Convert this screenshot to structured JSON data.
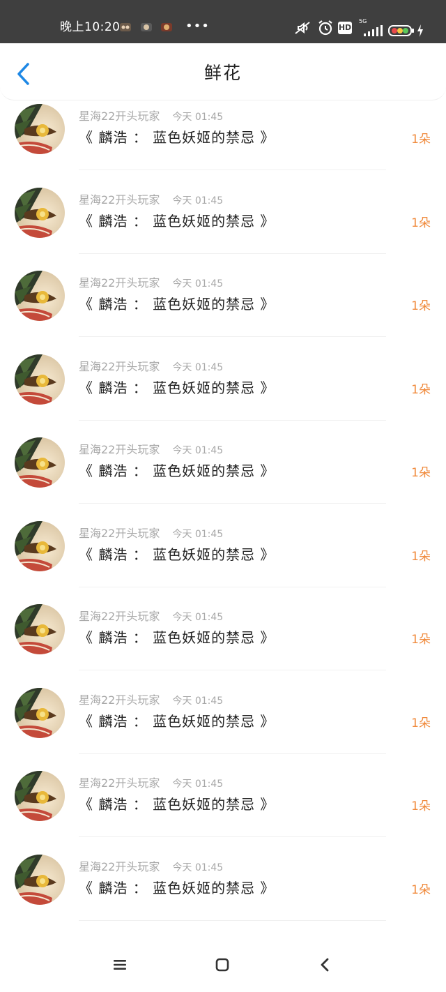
{
  "status_bar": {
    "time": "晚上10:20",
    "more": "•••",
    "hd_label": "HD",
    "network_label": "5G",
    "notification_icons": [
      "app-icon-a",
      "app-icon-b",
      "app-icon-c"
    ],
    "right_icons": [
      "mute-icon",
      "alarm-icon",
      "hd-icon",
      "signal-icon",
      "battery-icon",
      "charging-icon"
    ]
  },
  "header": {
    "title": "鲜花",
    "back_icon": "chevron-left-icon"
  },
  "records": [
    {
      "user": "星海22开头玩家",
      "time": "今天 01:45",
      "title": "《 麟浩 ： 蓝色妖姬的禁忌 》",
      "count": "1朵"
    },
    {
      "user": "星海22开头玩家",
      "time": "今天 01:45",
      "title": "《 麟浩 ： 蓝色妖姬的禁忌 》",
      "count": "1朵"
    },
    {
      "user": "星海22开头玩家",
      "time": "今天 01:45",
      "title": "《 麟浩 ： 蓝色妖姬的禁忌 》",
      "count": "1朵"
    },
    {
      "user": "星海22开头玩家",
      "time": "今天 01:45",
      "title": "《 麟浩 ： 蓝色妖姬的禁忌 》",
      "count": "1朵"
    },
    {
      "user": "星海22开头玩家",
      "time": "今天 01:45",
      "title": "《 麟浩 ： 蓝色妖姬的禁忌 》",
      "count": "1朵"
    },
    {
      "user": "星海22开头玩家",
      "time": "今天 01:45",
      "title": "《 麟浩 ： 蓝色妖姬的禁忌 》",
      "count": "1朵"
    },
    {
      "user": "星海22开头玩家",
      "time": "今天 01:45",
      "title": "《 麟浩 ： 蓝色妖姬的禁忌 》",
      "count": "1朵"
    },
    {
      "user": "星海22开头玩家",
      "time": "今天 01:45",
      "title": "《 麟浩 ： 蓝色妖姬的禁忌 》",
      "count": "1朵"
    },
    {
      "user": "星海22开头玩家",
      "time": "今天 01:45",
      "title": "《 麟浩 ： 蓝色妖姬的禁忌 》",
      "count": "1朵"
    },
    {
      "user": "星海22开头玩家",
      "time": "今天 01:45",
      "title": "《 麟浩 ： 蓝色妖姬的禁忌 》",
      "count": "1朵"
    }
  ],
  "nav_bar": {
    "menu_icon": "menu-icon",
    "home_icon": "home-square-icon",
    "back_icon": "back-chevron-icon"
  },
  "colors": {
    "status_bar_bg": "#3f3f3f",
    "accent_blue": "#1e88e5",
    "count_orange": "#f08a3c",
    "meta_gray": "#a8a8a8",
    "title_text": "#222222"
  }
}
